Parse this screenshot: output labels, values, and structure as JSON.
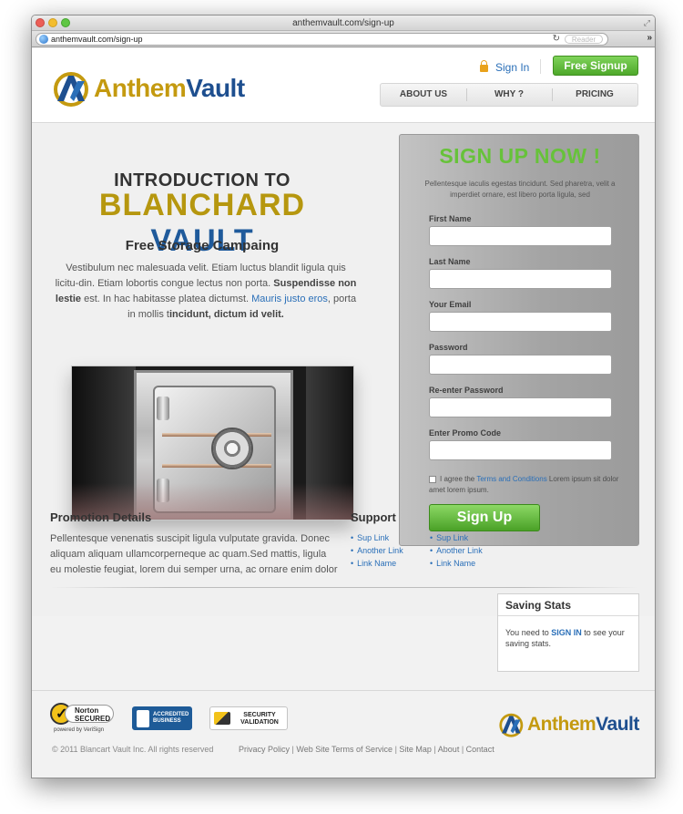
{
  "browser": {
    "window_title": "anthemvault.com/sign-up",
    "url": "anthemvault.com/sign-up",
    "reader_label": "Reader"
  },
  "header": {
    "logo_part1": "Anthem",
    "logo_part2": "Vault",
    "signin": "Sign In",
    "free_signup": "Free Signup",
    "nav": [
      "ABOUT US",
      "WHY ?",
      "PRICING"
    ]
  },
  "hero": {
    "intro": "INTRODUCTION TO",
    "title_part1": "BLANCHARD",
    "title_part2": "VAULT",
    "campaign": "Free Storage Campaing",
    "desc_1": "Vestibulum nec malesuada velit. Etiam luctus blandit ligula quis licitu-din. Etiam lobortis congue lectus non porta. ",
    "desc_bold_1": "Suspendisse non lestie",
    "desc_2": " est. In hac habitasse platea dictumst. ",
    "desc_link": "Mauris justo eros",
    "desc_3": ", porta in mollis t",
    "desc_bold_2": "incidunt, dictum id velit."
  },
  "signup": {
    "title": "SIGN UP NOW !",
    "subtitle": "Pellentesque iaculis egestas tincidunt. Sed pharetra, velit a imperdiet ornare, est libero porta ligula, sed",
    "fields": [
      "First Name",
      "Last Name",
      "Your Email",
      "Password",
      "Re-enter Password",
      "Enter Promo Code"
    ],
    "agree_1": "I agree the ",
    "agree_link": "Terms and Conditions",
    "agree_2": " Lorem ipsum sit dolor amet lorem ipsum.",
    "button": "Sign Up"
  },
  "promotion": {
    "heading": "Promotion Details",
    "text": "Pellentesque venenatis suscipit ligula vulputate gravida. Donec aliquam aliquam ullamcorperneque ac quam.Sed mattis, ligula eu molestie feugiat, lorem dui semper urna, ac ornare enim dolor"
  },
  "support": {
    "heading": "Support",
    "col1": [
      "Sup Link",
      "Another Link",
      "Link Name"
    ],
    "col2": [
      "Sup Link",
      "Another Link",
      "Link Name"
    ]
  },
  "stats": {
    "heading": "Saving Stats",
    "text_1": "You need to ",
    "link": "SIGN IN",
    "text_2": " to see your saving stats."
  },
  "footer": {
    "norton_1": "Norton",
    "norton_2": "SECURED",
    "norton_powered": "powered by VeriSign",
    "bbb_1": "ACCREDITED",
    "bbb_2": "BUSINESS",
    "security_1": "SECURITY",
    "security_2": "VALIDATION",
    "copyright": "© 2011 Blancart Vault Inc. All rights reserved",
    "links": [
      "Privacy Policy",
      "Web Site Terms of Service",
      "Site Map",
      "About",
      "Contact"
    ]
  },
  "colors": {
    "brand_gold": "#c49a10",
    "brand_blue": "#1e4f8f",
    "accent_green": "#67c23a",
    "link_blue": "#2a6fb8"
  }
}
